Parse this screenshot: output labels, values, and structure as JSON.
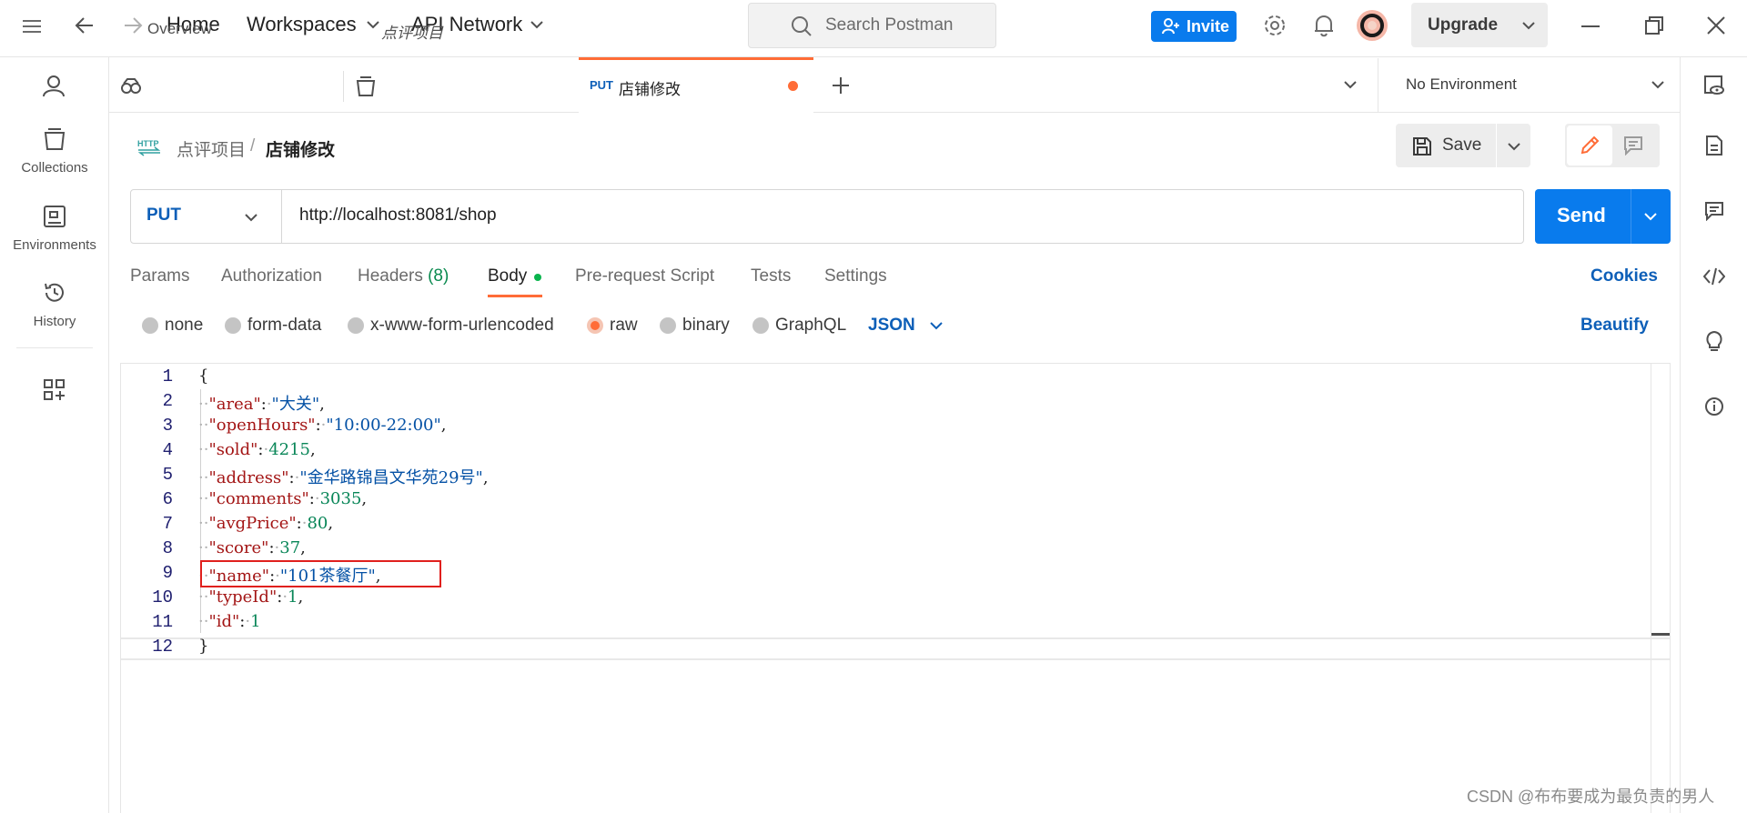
{
  "header": {
    "home": "Home",
    "workspaces": "Workspaces",
    "api_network": "API Network",
    "search_placeholder": "Search Postman",
    "invite": "Invite",
    "upgrade": "Upgrade"
  },
  "sidebar": {
    "items": [
      {
        "label": "Collections",
        "icon": "collections-icon"
      },
      {
        "label": "Environments",
        "icon": "environments-icon"
      },
      {
        "label": "History",
        "icon": "history-icon"
      }
    ]
  },
  "tabs": {
    "items": [
      {
        "label": "Overview"
      },
      {
        "label": "点评项目"
      },
      {
        "method": "PUT",
        "label": "店铺修改"
      }
    ],
    "environment": "No Environment"
  },
  "breadcrumb": {
    "badge": "HTTP",
    "collection": "点评项目",
    "separator": "/",
    "request": "店铺修改"
  },
  "actions": {
    "save": "Save"
  },
  "request": {
    "method": "PUT",
    "url": "http://localhost:8081/shop",
    "send": "Send"
  },
  "request_tabs": {
    "params": "Params",
    "authorization": "Authorization",
    "headers": "Headers",
    "headers_count": "(8)",
    "body": "Body",
    "pre_request": "Pre-request Script",
    "tests": "Tests",
    "settings": "Settings",
    "cookies": "Cookies"
  },
  "body_types": {
    "none": "none",
    "form_data": "form-data",
    "urlencoded": "x-www-form-urlencoded",
    "raw": "raw",
    "binary": "binary",
    "graphql": "GraphQL",
    "format": "JSON",
    "beautify": "Beautify"
  },
  "editor": {
    "line_numbers": [
      "1",
      "2",
      "3",
      "4",
      "5",
      "6",
      "7",
      "8",
      "9",
      "10",
      "11",
      "12"
    ],
    "lines": [
      {
        "key": "area",
        "value": "\"大关\"",
        "type": "s"
      },
      {
        "key": "openHours",
        "value": "\"10:00-22:00\"",
        "type": "s"
      },
      {
        "key": "sold",
        "value": "4215",
        "type": "n"
      },
      {
        "key": "address",
        "value": "\"金华路锦昌文华苑29号\"",
        "type": "s"
      },
      {
        "key": "comments",
        "value": "3035",
        "type": "n"
      },
      {
        "key": "avgPrice",
        "value": "80",
        "type": "n"
      },
      {
        "key": "score",
        "value": "37",
        "type": "n"
      },
      {
        "key": "name",
        "value": "\"101茶餐厅\"",
        "type": "s"
      },
      {
        "key": "typeId",
        "value": "1",
        "type": "n"
      },
      {
        "key": "id",
        "value": "1",
        "type": "n"
      }
    ],
    "open_brace": "{",
    "close_brace": "}"
  },
  "watermark": "CSDN @布布要成为最负责的男人",
  "colors": {
    "accent": "#ff6c37",
    "primary": "#097bed",
    "highlight": "#e0201d"
  }
}
